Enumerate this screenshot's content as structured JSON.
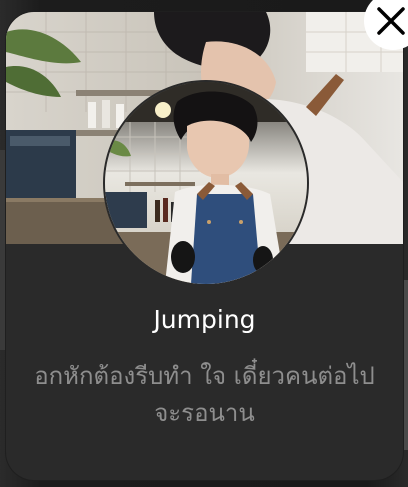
{
  "profile": {
    "name": "Jumping",
    "status": "อกหักต้องรีบทำ ใจ เดี๋ยวคนต่อไปจะรอนาน"
  },
  "icons": {
    "close": "close-icon"
  },
  "colors": {
    "card_background": "#2a2a2a",
    "name_text": "#ffffff",
    "status_text": "#8e8e8e",
    "close_button_bg": "#ffffff",
    "close_button_icon": "#000000"
  }
}
